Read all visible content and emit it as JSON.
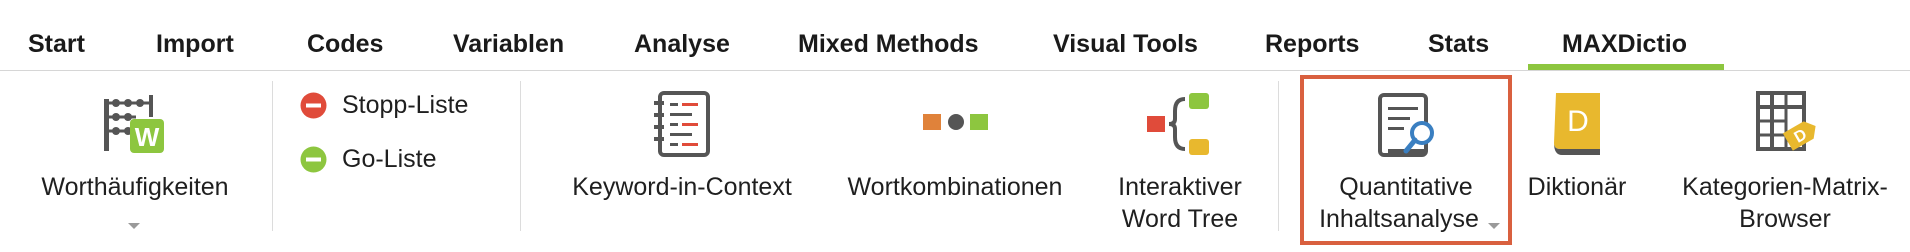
{
  "tabs": [
    {
      "label": "Start"
    },
    {
      "label": "Import"
    },
    {
      "label": "Codes"
    },
    {
      "label": "Variablen"
    },
    {
      "label": "Analyse"
    },
    {
      "label": "Mixed Methods"
    },
    {
      "label": "Visual Tools"
    },
    {
      "label": "Reports"
    },
    {
      "label": "Stats"
    },
    {
      "label": "MAXDictio"
    }
  ],
  "active_tab": "MAXDictio",
  "colors": {
    "accent_green": "#8dc63f",
    "red": "#e04b3a",
    "orange": "#e0823a",
    "yellow": "#e8b82e",
    "highlight_border": "#d9603f",
    "dark_icon": "#555555"
  },
  "ribbon": {
    "worthaeufigkeiten": {
      "label": "Worthäufigkeiten",
      "icon": "abacus-w-icon"
    },
    "stopp_liste": {
      "label": "Stopp-Liste",
      "icon": "minus-red-icon"
    },
    "go_liste": {
      "label": "Go-Liste",
      "icon": "minus-green-icon"
    },
    "kwic": {
      "label": "Keyword-in-Context",
      "icon": "notebook-icon"
    },
    "wortkombinationen": {
      "label": "Wortkombinationen",
      "icon": "word-combination-icon"
    },
    "word_tree": {
      "line1": "Interaktiver",
      "line2": "Word Tree",
      "icon": "word-tree-icon"
    },
    "quant_inhaltsanalyse": {
      "line1": "Quantitative",
      "line2": "Inhaltsanalyse",
      "icon": "document-search-icon",
      "highlighted": true
    },
    "diktionaer": {
      "label": "Diktionär",
      "icon": "dictionary-book-icon"
    },
    "kategorien_matrix": {
      "line1": "Kategorien-Matrix-",
      "line2": "Browser",
      "icon": "matrix-tag-icon"
    }
  }
}
